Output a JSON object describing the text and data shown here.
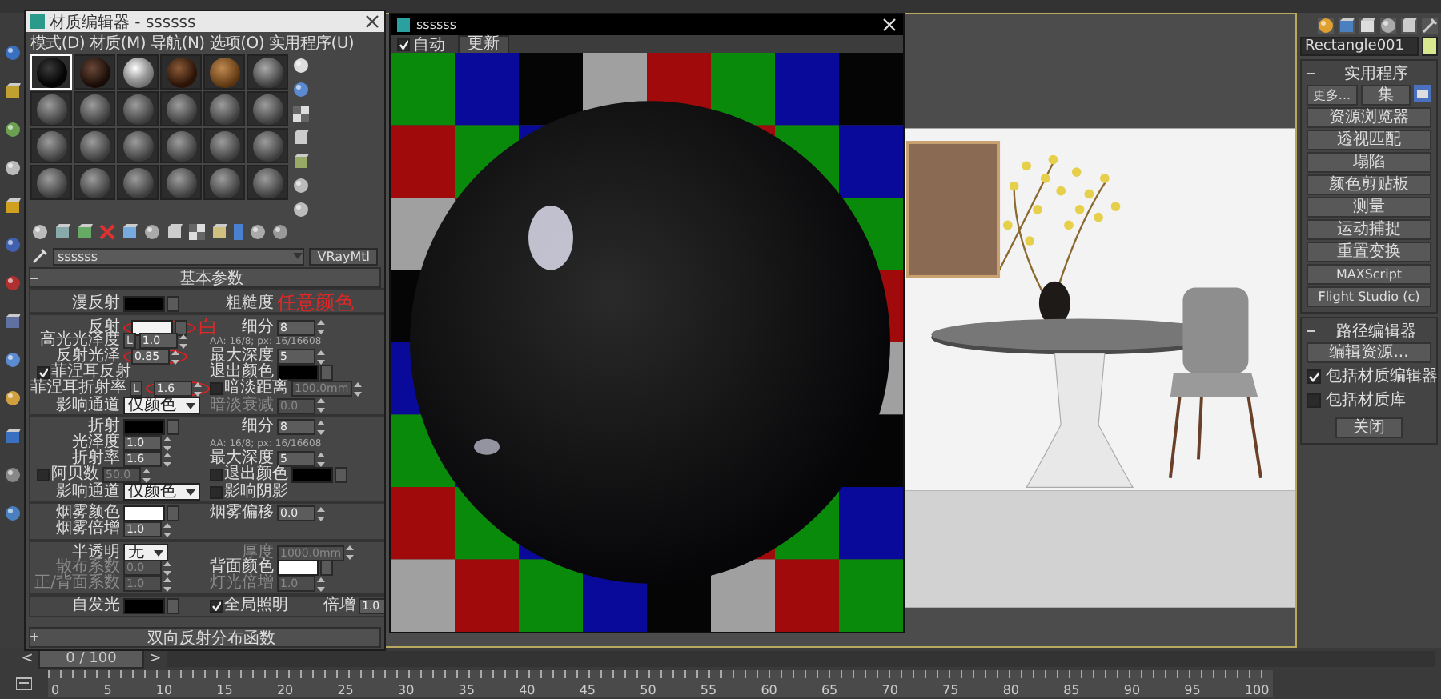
{
  "material_editor": {
    "title": "材质编辑器 - ssssss",
    "menu": [
      "模式(D)",
      "材质(M)",
      "导航(N)",
      "选项(O)",
      "实用程序(U)"
    ],
    "slots": [
      {
        "kind": "black",
        "selected": true
      },
      {
        "kind": "dark-brown",
        "selected": false
      },
      {
        "kind": "chrome",
        "selected": false
      },
      {
        "kind": "brown",
        "selected": false
      },
      {
        "kind": "wood",
        "selected": false
      },
      {
        "kind": "gray",
        "selected": false
      },
      {
        "kind": "default",
        "selected": false
      },
      {
        "kind": "default",
        "selected": false
      },
      {
        "kind": "default",
        "selected": false
      },
      {
        "kind": "default",
        "selected": false
      },
      {
        "kind": "default",
        "selected": false
      },
      {
        "kind": "default",
        "selected": false
      },
      {
        "kind": "default",
        "selected": false
      },
      {
        "kind": "default",
        "selected": false
      },
      {
        "kind": "default",
        "selected": false
      },
      {
        "kind": "default",
        "selected": false
      },
      {
        "kind": "default",
        "selected": false
      },
      {
        "kind": "default",
        "selected": false
      },
      {
        "kind": "default",
        "selected": false
      },
      {
        "kind": "default",
        "selected": false
      },
      {
        "kind": "default",
        "selected": false
      },
      {
        "kind": "default",
        "selected": false
      },
      {
        "kind": "default",
        "selected": false
      },
      {
        "kind": "default",
        "selected": false
      }
    ],
    "material_name": "ssssss",
    "material_type": "VRayMtl",
    "rollout_title": "基本参数",
    "groups": [
      [
        {
          "left": [
            {
              "kind": "label",
              "text": "漫反射"
            },
            {
              "kind": "swatch",
              "color": "#000000"
            }
          ],
          "right": [
            {
              "kind": "label",
              "text": "粗糙度"
            },
            {
              "kind": "annotation",
              "text": "任意颜色"
            }
          ]
        }
      ],
      [
        {
          "left": [
            {
              "kind": "label",
              "text": "反射"
            },
            {
              "kind": "swatch",
              "color": "#f4f4f4",
              "circled": true
            },
            {
              "kind": "annotation",
              "text": "白"
            }
          ],
          "right": [
            {
              "kind": "label",
              "text": "细分"
            },
            {
              "kind": "spinner",
              "value": "8"
            }
          ]
        },
        {
          "left": [
            {
              "kind": "label",
              "text": "高光光泽度"
            },
            {
              "kind": "lock",
              "text": "L"
            },
            {
              "kind": "spinner",
              "value": "1.0"
            }
          ],
          "right": [
            {
              "kind": "note",
              "text": "AA: 16/8; px: 16/16608"
            }
          ]
        },
        {
          "left": [
            {
              "kind": "label",
              "text": "反射光泽"
            },
            {
              "kind": "spinner",
              "value": "0.85",
              "circled": true
            }
          ],
          "right": [
            {
              "kind": "label",
              "text": "最大深度"
            },
            {
              "kind": "spinner",
              "value": "5"
            }
          ]
        },
        {
          "left": [
            {
              "kind": "check",
              "text": "菲涅耳反射",
              "checked": true
            }
          ],
          "right": [
            {
              "kind": "label",
              "text": "退出颜色"
            },
            {
              "kind": "swatch",
              "color": "#000000"
            }
          ]
        },
        {
          "left": [
            {
              "kind": "label",
              "text": "菲涅耳折射率"
            },
            {
              "kind": "lock",
              "text": "L"
            },
            {
              "kind": "spinner",
              "value": "1.6",
              "circled": true
            }
          ],
          "right": [
            {
              "kind": "check",
              "text": "暗淡距离",
              "checked": false
            },
            {
              "kind": "spinner",
              "value": "100.0mm",
              "disabled": true
            }
          ]
        },
        {
          "left": [
            {
              "kind": "label",
              "text": "影响通道"
            },
            {
              "kind": "dropdown",
              "value": "仅颜色"
            }
          ],
          "right": [
            {
              "kind": "label",
              "text": "暗淡衰减",
              "disabled": true
            },
            {
              "kind": "spinner",
              "value": "0.0",
              "disabled": true
            }
          ]
        }
      ],
      [
        {
          "left": [
            {
              "kind": "label",
              "text": "折射"
            },
            {
              "kind": "swatch",
              "color": "#000000"
            }
          ],
          "right": [
            {
              "kind": "label",
              "text": "细分"
            },
            {
              "kind": "spinner",
              "value": "8"
            }
          ]
        },
        {
          "left": [
            {
              "kind": "label",
              "text": "光泽度"
            },
            {
              "kind": "spinner",
              "value": "1.0"
            }
          ],
          "right": [
            {
              "kind": "note",
              "text": "AA: 16/8; px: 16/16608"
            }
          ]
        },
        {
          "left": [
            {
              "kind": "label",
              "text": "折射率"
            },
            {
              "kind": "spinner",
              "value": "1.6"
            }
          ],
          "right": [
            {
              "kind": "label",
              "text": "最大深度"
            },
            {
              "kind": "spinner",
              "value": "5"
            }
          ]
        },
        {
          "left": [
            {
              "kind": "check",
              "text": "阿贝数",
              "checked": false
            },
            {
              "kind": "spinner",
              "value": "50.0",
              "disabled": true
            }
          ],
          "right": [
            {
              "kind": "check",
              "text": "退出颜色",
              "checked": false
            },
            {
              "kind": "swatch",
              "color": "#000000"
            }
          ]
        },
        {
          "left": [
            {
              "kind": "label",
              "text": "影响通道"
            },
            {
              "kind": "dropdown",
              "value": "仅颜色"
            }
          ],
          "right": [
            {
              "kind": "check",
              "text": "影响阴影",
              "checked": false
            }
          ]
        }
      ],
      [
        {
          "left": [
            {
              "kind": "label",
              "text": "烟雾颜色"
            },
            {
              "kind": "swatch",
              "color": "#ffffff"
            }
          ],
          "right": [
            {
              "kind": "label",
              "text": "烟雾偏移"
            },
            {
              "kind": "spinner",
              "value": "0.0"
            }
          ]
        },
        {
          "left": [
            {
              "kind": "label",
              "text": "烟雾倍增"
            },
            {
              "kind": "spinner",
              "value": "1.0"
            }
          ]
        }
      ],
      [
        {
          "left": [
            {
              "kind": "label",
              "text": "半透明"
            },
            {
              "kind": "dropdown",
              "value": "无"
            }
          ],
          "right": [
            {
              "kind": "label",
              "text": "厚度",
              "disabled": true
            },
            {
              "kind": "spinner",
              "value": "1000.0mm",
              "disabled": true
            }
          ]
        },
        {
          "left": [
            {
              "kind": "label",
              "text": "散布系数",
              "disabled": true
            },
            {
              "kind": "spinner",
              "value": "0.0",
              "disabled": true
            }
          ],
          "right": [
            {
              "kind": "label",
              "text": "背面颜色"
            },
            {
              "kind": "swatch",
              "color": "#ffffff"
            }
          ]
        },
        {
          "left": [
            {
              "kind": "label",
              "text": "正/背面系数",
              "disabled": true
            },
            {
              "kind": "spinner",
              "value": "1.0",
              "disabled": true
            }
          ],
          "right": [
            {
              "kind": "label",
              "text": "灯光倍增",
              "disabled": true
            },
            {
              "kind": "spinner",
              "value": "1.0",
              "disabled": true
            }
          ]
        }
      ],
      [
        {
          "left": [
            {
              "kind": "label",
              "text": "自发光"
            },
            {
              "kind": "swatch",
              "color": "#000000"
            }
          ],
          "right": [
            {
              "kind": "check",
              "text": "全局照明",
              "checked": true
            },
            {
              "kind": "label",
              "text": "倍增"
            },
            {
              "kind": "spinner",
              "value": "1.0"
            }
          ]
        }
      ]
    ],
    "bottom_rollout": "双向反射分布函数"
  },
  "preview": {
    "title": "ssssss",
    "auto": {
      "label": "自动",
      "checked": true
    },
    "update_button": "更新"
  },
  "command_panel": {
    "object": {
      "name": "Rectangle001",
      "color": "#d8e890"
    },
    "utilities": {
      "title": "实用程序",
      "more_button": "更多...",
      "sets_button": "集",
      "buttons": [
        "资源浏览器",
        "透视匹配",
        "塌陷",
        "颜色剪贴板",
        "测量",
        "运动捕捉",
        "重置变换",
        "MAXScript",
        "Flight Studio (c)"
      ]
    },
    "path_editor": {
      "title": "路径编辑器",
      "edit_button": "编辑资源...",
      "options": [
        {
          "label": "包括材质编辑器",
          "checked": true
        },
        {
          "label": "包括材质库",
          "checked": false
        }
      ],
      "close_button": "关闭"
    }
  },
  "timeline": {
    "prev": "<",
    "frame": "0 / 100",
    "next": ">",
    "ruler_labels": [
      "0",
      "5",
      "10",
      "15",
      "20",
      "25",
      "30",
      "35",
      "40",
      "45",
      "50",
      "55",
      "60",
      "65",
      "70",
      "75",
      "80",
      "85",
      "90",
      "95",
      "100"
    ]
  }
}
